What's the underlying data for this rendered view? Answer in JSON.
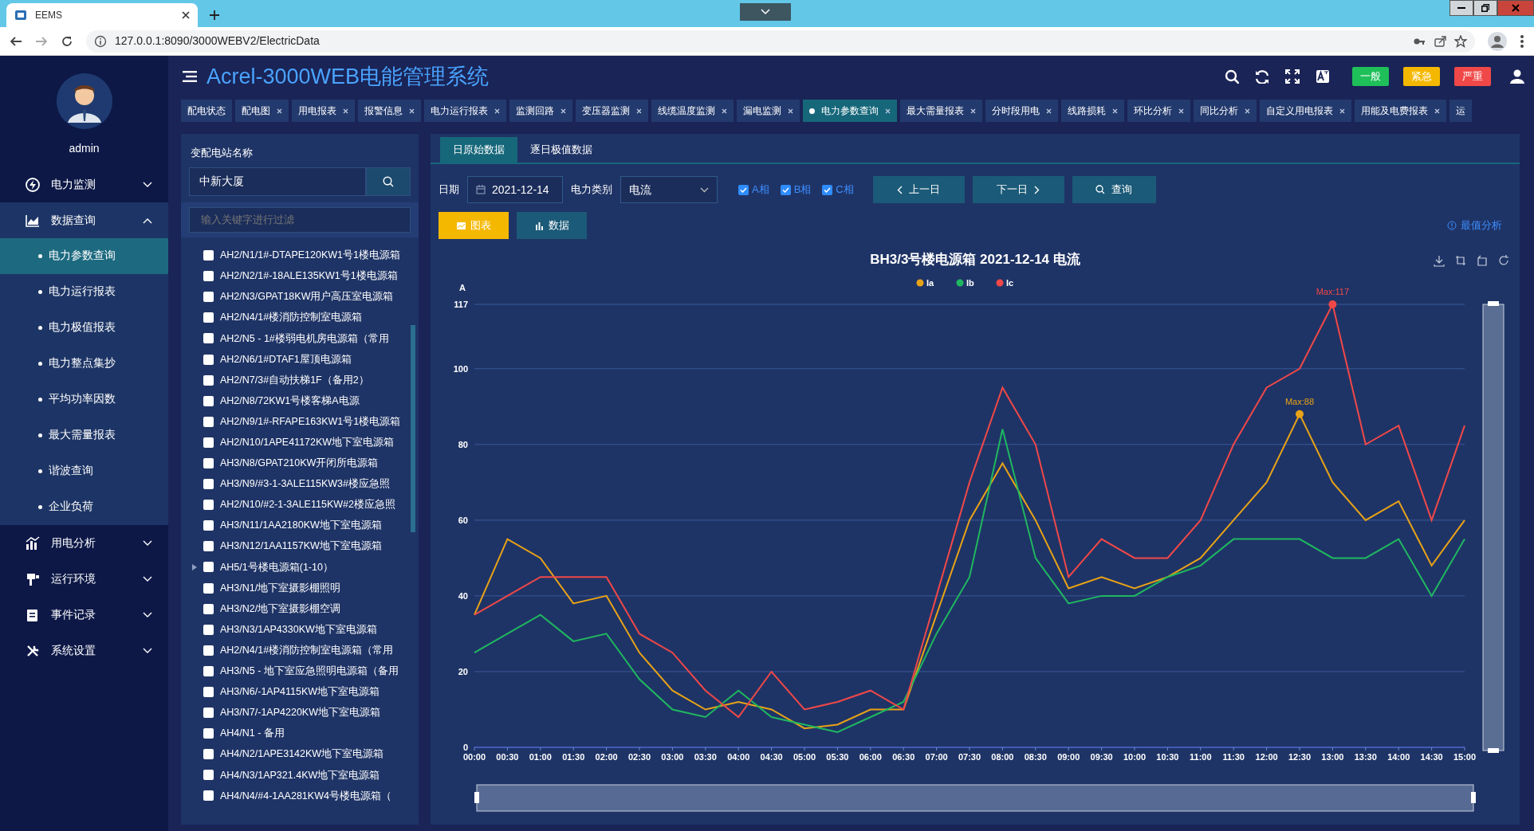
{
  "browser": {
    "tab_title": "EEMS",
    "url": "127.0.0.1:8090/3000WEBV2/ElectricData"
  },
  "sidebar": {
    "user": "admin",
    "menu": [
      {
        "label": "电力监测",
        "expanded": false
      },
      {
        "label": "数据查询",
        "expanded": true,
        "children": [
          {
            "label": "电力参数查询",
            "selected": true
          },
          {
            "label": "电力运行报表",
            "selected": false
          },
          {
            "label": "电力极值报表",
            "selected": false
          },
          {
            "label": "电力整点集抄",
            "selected": false
          },
          {
            "label": "平均功率因数",
            "selected": false
          },
          {
            "label": "最大需量报表",
            "selected": false
          },
          {
            "label": "谐波查询",
            "selected": false
          },
          {
            "label": "企业负荷",
            "selected": false
          }
        ]
      },
      {
        "label": "用电分析",
        "expanded": false
      },
      {
        "label": "运行环境",
        "expanded": false
      },
      {
        "label": "事件记录",
        "expanded": false
      },
      {
        "label": "系统设置",
        "expanded": false
      }
    ]
  },
  "header": {
    "title": "Acrel-3000WEB电能管理系统",
    "alarm_buttons": [
      {
        "label": "一般",
        "color": "#1fbf5a"
      },
      {
        "label": "紧急",
        "color": "#f5b800"
      },
      {
        "label": "严重",
        "color": "#f04848"
      }
    ]
  },
  "tabs": [
    {
      "label": "配电状态",
      "selected": false,
      "closable": false
    },
    {
      "label": "配电图",
      "selected": false,
      "closable": true
    },
    {
      "label": "用电报表",
      "selected": false,
      "closable": true
    },
    {
      "label": "报警信息",
      "selected": false,
      "closable": true
    },
    {
      "label": "电力运行报表",
      "selected": false,
      "closable": true
    },
    {
      "label": "监测回路",
      "selected": false,
      "closable": true
    },
    {
      "label": "变压器监测",
      "selected": false,
      "closable": true
    },
    {
      "label": "线缆温度监测",
      "selected": false,
      "closable": true
    },
    {
      "label": "漏电监测",
      "selected": false,
      "closable": true
    },
    {
      "label": "电力参数查询",
      "selected": true,
      "closable": true
    },
    {
      "label": "最大需量报表",
      "selected": false,
      "closable": true
    },
    {
      "label": "分时段用电",
      "selected": false,
      "closable": true
    },
    {
      "label": "线路损耗",
      "selected": false,
      "closable": true
    },
    {
      "label": "环比分析",
      "selected": false,
      "closable": true
    },
    {
      "label": "同比分析",
      "selected": false,
      "closable": true
    },
    {
      "label": "自定义用电报表",
      "selected": false,
      "closable": true
    },
    {
      "label": "用能及电费报表",
      "selected": false,
      "closable": true
    },
    {
      "label": "运",
      "selected": false,
      "closable": false
    }
  ],
  "station_panel": {
    "label": "变配电站名称",
    "value": "中新大厦",
    "filter_placeholder": "输入关键字进行过滤",
    "items": [
      {
        "label": "AH2/N1/1#-DTAPE120KW1号1楼电源箱",
        "checked": false,
        "kind": "leaf"
      },
      {
        "label": "AH2/N2/1#-18ALE135KW1号1楼电源箱",
        "checked": false,
        "kind": "leaf"
      },
      {
        "label": "AH2/N3/GPAT18KW用户高压室电源箱",
        "checked": false,
        "kind": "leaf"
      },
      {
        "label": "AH2/N4/1#楼消防控制室电源箱",
        "checked": false,
        "kind": "leaf"
      },
      {
        "label": "AH2/N5 - 1#楼弱电机房电源箱（常用",
        "checked": false,
        "kind": "leaf"
      },
      {
        "label": "AH2/N6/1#DTAF1屋顶电源箱",
        "checked": false,
        "kind": "leaf"
      },
      {
        "label": "AH2/N7/3#自动扶梯1F（备用2）",
        "checked": false,
        "kind": "leaf"
      },
      {
        "label": "AH2/N8/72KW1号楼客梯A电源",
        "checked": false,
        "kind": "leaf"
      },
      {
        "label": "AH2/N9/1#-RFAPE163KW1号1楼电源箱",
        "checked": false,
        "kind": "leaf"
      },
      {
        "label": "AH2/N10/1APE41172KW地下室电源箱",
        "checked": false,
        "kind": "leaf"
      },
      {
        "label": "AH3/N8/GPAT210KW开闭所电源箱",
        "checked": false,
        "kind": "leaf"
      },
      {
        "label": "AH3/N9/#3-1-3ALE115KW3#楼应急照",
        "checked": false,
        "kind": "leaf"
      },
      {
        "label": "AH2/N10/#2-1-3ALE115KW#2楼应急照",
        "checked": false,
        "kind": "leaf"
      },
      {
        "label": "AH3/N11/1AA2180KW地下室电源箱",
        "checked": false,
        "kind": "leaf"
      },
      {
        "label": "AH3/N12/1AA1157KW地下室电源箱",
        "checked": false,
        "kind": "leaf"
      },
      {
        "label": "AH5/1号楼电源箱(1-10）",
        "checked": false,
        "kind": "group"
      },
      {
        "label": "AH3/N1/地下室摄影棚照明",
        "checked": false,
        "kind": "leaf"
      },
      {
        "label": "AH3/N2/地下室摄影棚空调",
        "checked": false,
        "kind": "leaf"
      },
      {
        "label": "AH3/N3/1AP4330KW地下室电源箱",
        "checked": false,
        "kind": "leaf"
      },
      {
        "label": "AH2/N4/1#楼消防控制室电源箱（常用",
        "checked": false,
        "kind": "leaf"
      },
      {
        "label": "AH3/N5 - 地下室应急照明电源箱（备用",
        "checked": false,
        "kind": "leaf"
      },
      {
        "label": "AH3/N6/-1AP4115KW地下室电源箱",
        "checked": false,
        "kind": "leaf"
      },
      {
        "label": "AH3/N7/-1AP4220KW地下室电源箱",
        "checked": false,
        "kind": "leaf"
      },
      {
        "label": "AH4/N1 - 备用",
        "checked": false,
        "kind": "leaf"
      },
      {
        "label": "AH4/N2/1APE3142KW地下室电源箱",
        "checked": false,
        "kind": "leaf"
      },
      {
        "label": "AH4/N3/1AP321.4KW地下室电源箱",
        "checked": false,
        "kind": "leaf"
      },
      {
        "label": "AH4/N4/#4-1AA281KW4号楼电源箱（",
        "checked": false,
        "kind": "leaf"
      }
    ]
  },
  "content": {
    "sub_tabs": [
      {
        "label": "日原始数据",
        "selected": true
      },
      {
        "label": "逐日极值数据",
        "selected": false
      }
    ],
    "filters": {
      "date_label": "日期",
      "date": "2021-12-14",
      "type_label": "电力类别",
      "type": "电流",
      "phases": [
        {
          "label": "A相",
          "checked": true
        },
        {
          "label": "B相",
          "checked": true
        },
        {
          "label": "C相",
          "checked": true
        }
      ],
      "prev": "上一日",
      "next": "下一日",
      "query": "查询"
    },
    "view_buttons": [
      {
        "label": "图表",
        "selected": true
      },
      {
        "label": "数据",
        "selected": false
      }
    ],
    "extreme_link": "最值分析",
    "chart": {
      "chart_data": {
        "type": "line",
        "title": "BH3/3号楼电源箱  2021-12-14  电流",
        "ylabel": "A",
        "ylim": [
          0,
          117
        ],
        "yticks": [
          0,
          20,
          40,
          60,
          80,
          100,
          117
        ],
        "categories": [
          "00:00",
          "00:30",
          "01:00",
          "01:30",
          "02:00",
          "02:30",
          "03:00",
          "03:30",
          "04:00",
          "04:30",
          "05:00",
          "05:30",
          "06:00",
          "06:30",
          "07:00",
          "07:30",
          "08:00",
          "08:30",
          "09:00",
          "09:30",
          "10:00",
          "10:30",
          "11:00",
          "11:30",
          "12:00",
          "12:30",
          "13:00",
          "13:30",
          "14:00",
          "14:30",
          "15:00"
        ],
        "series": [
          {
            "name": "Ia",
            "color": "#e8a317",
            "values": [
              35,
              55,
              50,
              38,
              40,
              25,
              15,
              10,
              12,
              10,
              5,
              6,
              10,
              10,
              35,
              60,
              75,
              60,
              42,
              45,
              42,
              45,
              50,
              60,
              70,
              88,
              70,
              60,
              65,
              48,
              60
            ]
          },
          {
            "name": "Ib",
            "color": "#1fb860",
            "values": [
              25,
              30,
              35,
              28,
              30,
              18,
              10,
              8,
              15,
              8,
              6,
              4,
              8,
              12,
              30,
              45,
              84,
              50,
              38,
              40,
              40,
              45,
              48,
              55,
              55,
              55,
              50,
              50,
              55,
              40,
              55
            ]
          },
          {
            "name": "Ic",
            "color": "#f04848",
            "values": [
              35,
              40,
              45,
              45,
              45,
              30,
              25,
              15,
              8,
              20,
              10,
              12,
              15,
              10,
              40,
              70,
              95,
              80,
              45,
              55,
              50,
              50,
              60,
              80,
              95,
              100,
              117,
              80,
              85,
              60,
              85
            ]
          }
        ],
        "grid": true,
        "legend": true,
        "annotations": [
          "Max:117",
          "Max:88"
        ]
      }
    }
  }
}
